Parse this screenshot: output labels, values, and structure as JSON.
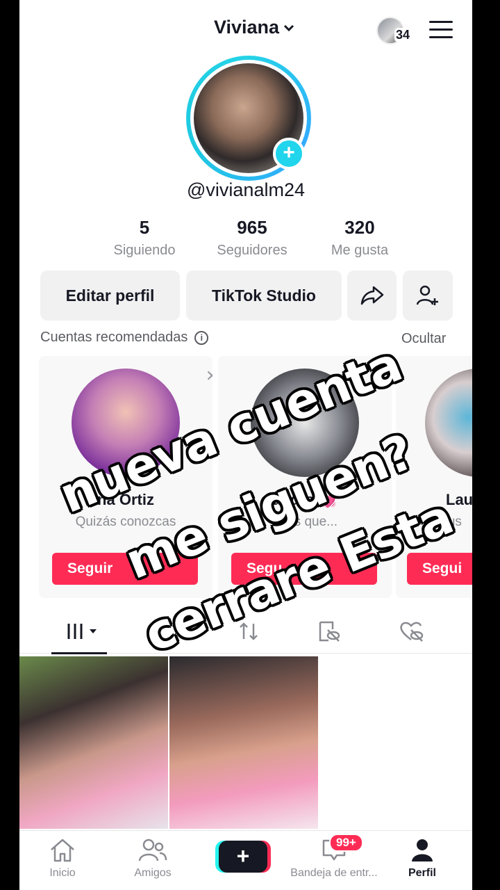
{
  "header": {
    "title": "Viviana",
    "following_count_badge": "34"
  },
  "profile": {
    "handle": "@vivianalm24"
  },
  "stats": [
    {
      "value": "5",
      "label": "Siguiendo"
    },
    {
      "value": "965",
      "label": "Seguidores"
    },
    {
      "value": "320",
      "label": "Me gusta"
    }
  ],
  "buttons": {
    "edit": "Editar perfil",
    "studio": "TikTok Studio"
  },
  "recommended": {
    "title": "Cuentas recomendadas",
    "hide": "Ocultar",
    "cards": [
      {
        "name": "na Ortiz",
        "sub": "Quizás conozcas",
        "button": "Seguir"
      },
      {
        "name": "andra 💓",
        "sub": "onas que...",
        "button": "Segu"
      },
      {
        "name": "Lau",
        "sub": "De tus",
        "button": "Segui"
      }
    ]
  },
  "caption": {
    "line1": "nueva cuenta",
    "line2": "me siguen?",
    "line3": "cerrare Esta"
  },
  "nav": {
    "home": "Inicio",
    "friends": "Amigos",
    "inbox": "Bandeja de entr...",
    "inbox_badge": "99+",
    "profile": "Perfil"
  },
  "colors": {
    "accent": "#fe2c55",
    "ring": "#25d3e7",
    "text": "#161823"
  }
}
